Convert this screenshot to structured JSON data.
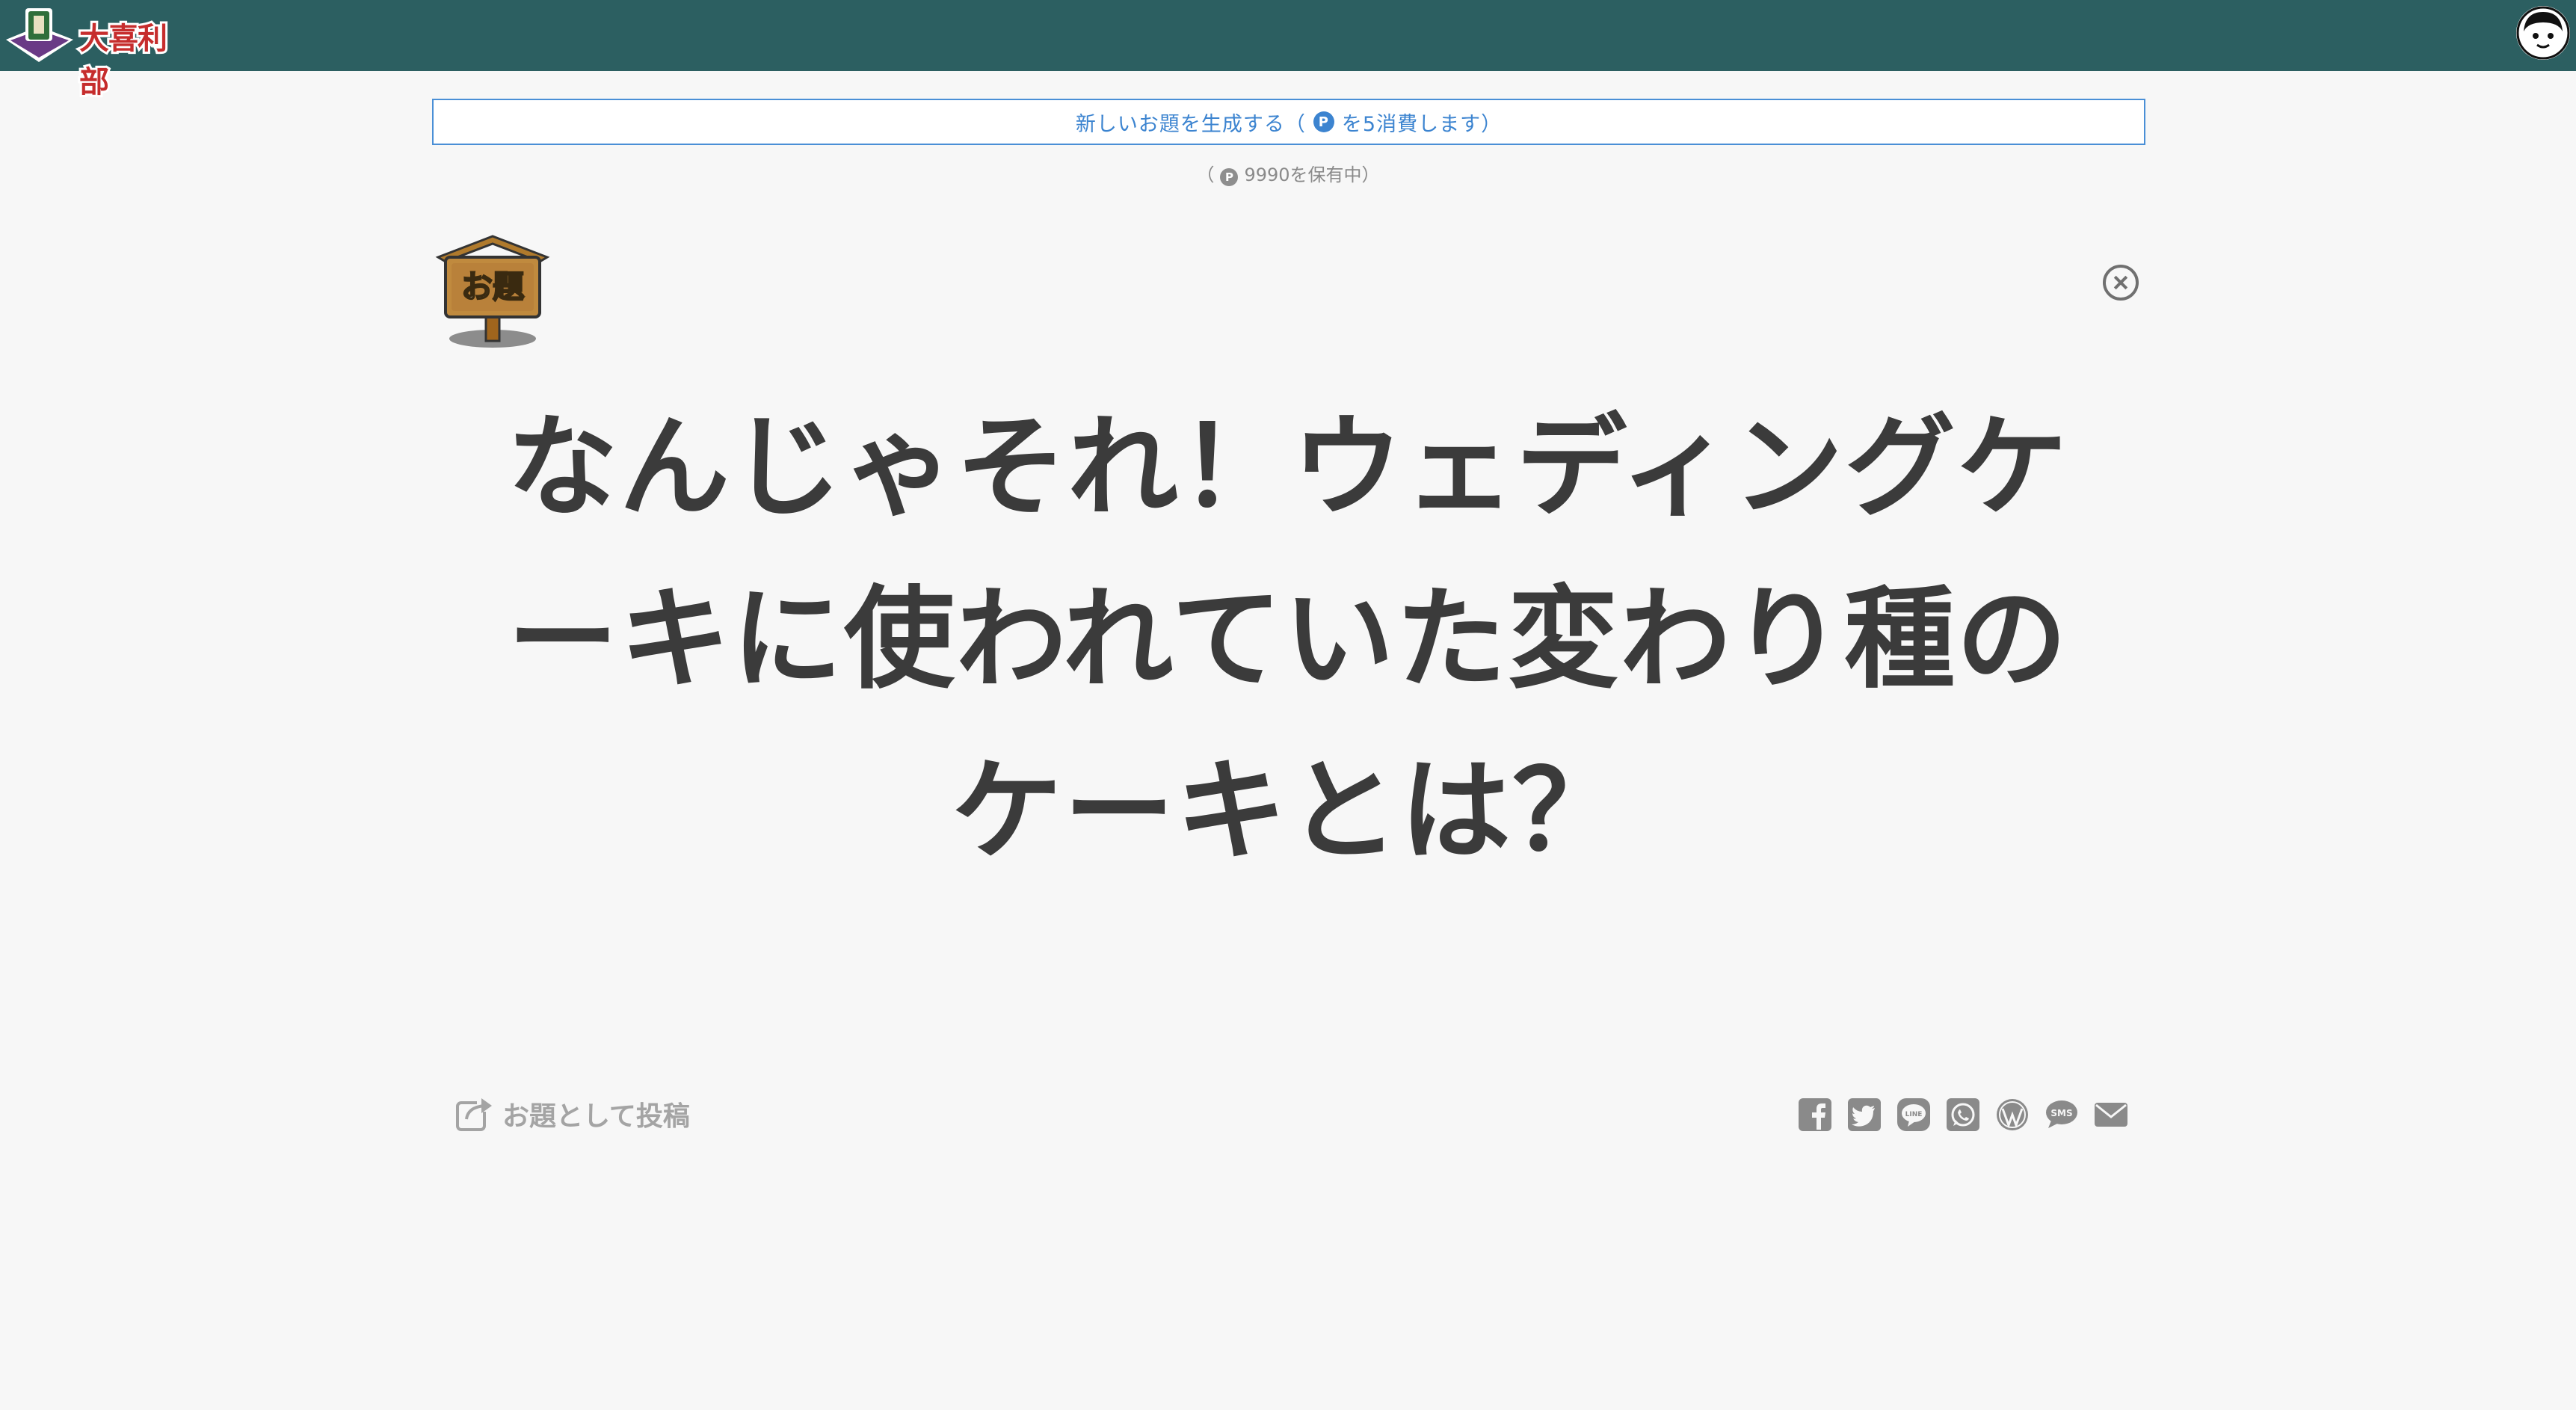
{
  "header": {
    "logo_text": "大喜利部",
    "logo_icon": "ogiri-hat-logo-icon",
    "avatar_icon": "user-avatar-icon"
  },
  "generate": {
    "label_before": "新しいお題を生成する（",
    "point_symbol": "P",
    "label_after": "を5消費します）"
  },
  "balance": {
    "prefix": "（",
    "point_symbol": "P",
    "text": "9990を保有中）"
  },
  "odai_badge": {
    "text": "お題",
    "icon": "odai-signboard-icon"
  },
  "topic": {
    "text": "なんじゃそれ！ウェディングケーキに使われていた変わり種のケーキとは？"
  },
  "actions": {
    "post_label": "お題として投稿",
    "post_icon": "share-arrow-icon"
  },
  "share": {
    "icons": [
      "facebook-icon",
      "twitter-icon",
      "line-icon",
      "whatsapp-icon",
      "wordpress-icon",
      "sms-icon",
      "email-icon"
    ]
  },
  "colors": {
    "header_bg": "#2c5f61",
    "accent_blue": "#3c84d0",
    "topic_text": "#3b3b3b",
    "muted": "#a4a4a4",
    "background": "#f7f7f7"
  }
}
